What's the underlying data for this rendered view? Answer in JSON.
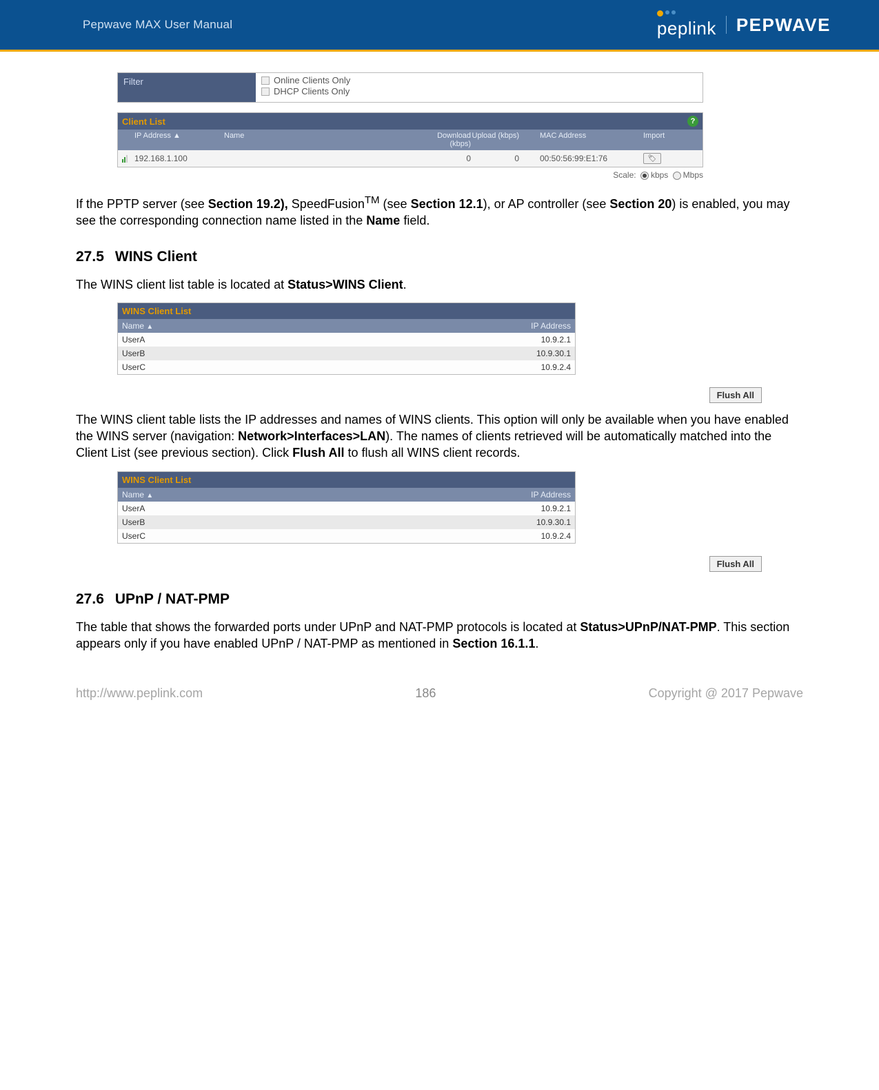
{
  "header": {
    "manual_title": "Pepwave MAX User Manual",
    "brand_peplink": "peplink",
    "brand_pepwave": "PEPWAVE"
  },
  "filter": {
    "label": "Filter",
    "opt1": "Online Clients Only",
    "opt2": "DHCP Clients Only"
  },
  "client_list": {
    "title": "Client List",
    "help": "?",
    "cols": {
      "ip": "IP Address ▲",
      "name": "Name",
      "download": "Download (kbps)",
      "upload": "Upload (kbps)",
      "mac": "MAC Address",
      "import": "Import"
    },
    "row": {
      "ip": "192.168.1.100",
      "name": "",
      "download": "0",
      "upload": "0",
      "mac": "00:50:56:99:E1:76",
      "tag": "🏷"
    },
    "scale_label": "Scale:",
    "scale_kbps": "kbps",
    "scale_mbps": "Mbps"
  },
  "para1": {
    "t1": "If the PPTP server (see ",
    "b1": "Section 19.2),",
    "t2": " SpeedFusion",
    "sup": "TM",
    "t3": " (see ",
    "b2": "Section 12.1",
    "t4": "), or AP controller (see ",
    "b3": "Section 20",
    "t5": ") is enabled, you may see the corresponding connection name listed in the ",
    "b4": "Name",
    "t6": " field."
  },
  "sec275": {
    "num": "27.5",
    "title": "WINS Client"
  },
  "para2": {
    "t1": "The WINS client list table is located at ",
    "b1": "Status>WINS Client",
    "t2": "."
  },
  "wins": {
    "title": "WINS Client List",
    "col_name": "Name",
    "tri": "▲",
    "col_ip": "IP Address",
    "rows": [
      {
        "name": "UserA",
        "ip": "10.9.2.1"
      },
      {
        "name": "UserB",
        "ip": "10.9.30.1"
      },
      {
        "name": "UserC",
        "ip": "10.9.2.4"
      }
    ],
    "flush": "Flush All"
  },
  "para3": {
    "t1": "The WINS client table lists the IP addresses and names of WINS clients. This option will only be available when you have enabled the WINS server (navigation: ",
    "b1": "Network>Interfaces>LAN",
    "t2": "). The names of clients retrieved will be automatically matched into the Client List (see previous section). Click ",
    "b2": "Flush All",
    "t3": " to flush all WINS client records."
  },
  "sec276": {
    "num": "27.6",
    "title": "UPnP / NAT-PMP"
  },
  "para4": {
    "t1": "The table that shows the forwarded ports under UPnP and NAT-PMP protocols is located at ",
    "b1": "Status>UPnP/NAT-PMP",
    "t2": ". This section appears only if you have enabled UPnP / NAT-PMP as mentioned in ",
    "b2": "Section ",
    "b3": "16.1.1",
    "t3": "."
  },
  "footer": {
    "url": "http://www.peplink.com",
    "page": "186",
    "copyright": "Copyright @ 2017 Pepwave"
  }
}
